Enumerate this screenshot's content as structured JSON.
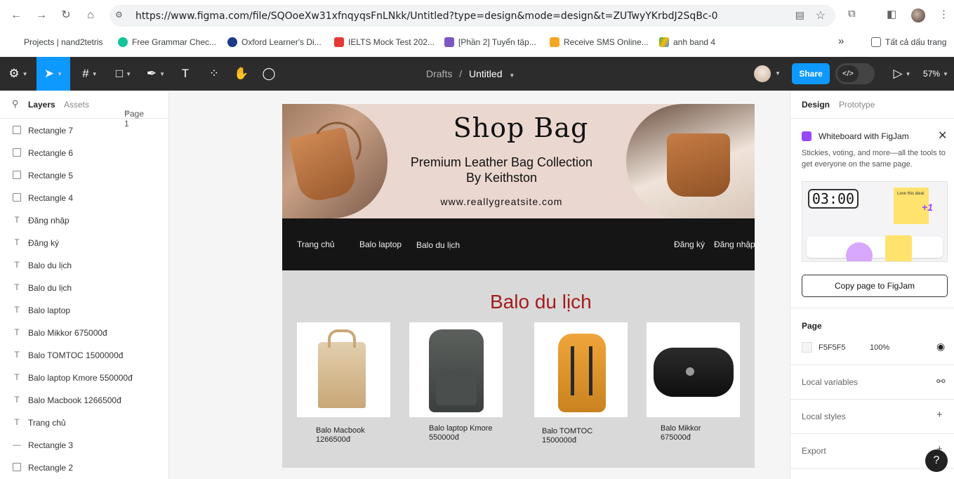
{
  "browser": {
    "url": "https://www.figma.com/file/SQOoeXw31xfnqyqsFnLNkk/Untitled?type=design&mode=design&t=ZUTwyYKrbdJ2SqBc-0",
    "bookmarks": [
      {
        "label": "Projects | nand2tetris",
        "color": "#ffffff"
      },
      {
        "label": "Free Grammar Chec...",
        "color": "#15c39a"
      },
      {
        "label": "Oxford Learner's Di...",
        "color": "#1d3a8a"
      },
      {
        "label": "IELTS Mock Test 202...",
        "color": "#e53935"
      },
      {
        "label": "[Phần 2] Tuyển tập...",
        "color": "#7e57c2"
      },
      {
        "label": "Receive SMS Online...",
        "color": "#f5a623"
      },
      {
        "label": "anh band 4",
        "color": "#34a853"
      }
    ],
    "bookmarks_more": "»",
    "all_bookmarks": "Tất cả dấu trang"
  },
  "toolbar": {
    "breadcrumb_parent": "Drafts",
    "breadcrumb_sep": "/",
    "file_name": "Untitled",
    "share_label": "Share",
    "zoom": "57%",
    "accent": "#0d99ff"
  },
  "left_panel": {
    "tab_layers": "Layers",
    "tab_assets": "Assets",
    "page_selector": "Page 1",
    "layers": [
      {
        "name": "Rectangle 7",
        "icon": "image"
      },
      {
        "name": "Rectangle 6",
        "icon": "image"
      },
      {
        "name": "Rectangle 5",
        "icon": "image"
      },
      {
        "name": "Rectangle 4",
        "icon": "image"
      },
      {
        "name": "Đăng nhập",
        "icon": "text"
      },
      {
        "name": "Đăng ký",
        "icon": "text"
      },
      {
        "name": "Balo du lịch",
        "icon": "text"
      },
      {
        "name": "Balo du lịch",
        "icon": "text"
      },
      {
        "name": "Balo laptop",
        "icon": "text"
      },
      {
        "name": "Balo Mikkor 675000đ",
        "icon": "text"
      },
      {
        "name": "Balo TOMTOC 1500000đ",
        "icon": "text"
      },
      {
        "name": "Balo laptop Kmore 550000đ",
        "icon": "text"
      },
      {
        "name": "Balo Macbook 1266500đ",
        "icon": "text"
      },
      {
        "name": "Trang chủ",
        "icon": "text"
      },
      {
        "name": "Rectangle 3",
        "icon": "line"
      },
      {
        "name": "Rectangle 2",
        "icon": "image"
      }
    ]
  },
  "design": {
    "hero_title": "Shop Bag",
    "hero_subtitle_1": "Premium Leather Bag Collection",
    "hero_subtitle_2": "By Keithston",
    "hero_url": "www.reallygreatsite.com",
    "nav": [
      "Trang chủ",
      "Balo laptop",
      "Balo du lịch",
      "Đăng ký",
      "Đăng nhập"
    ],
    "section_title": "Balo du lịch",
    "products": [
      {
        "name": "Balo Macbook",
        "price": "1266500đ"
      },
      {
        "name": "Balo laptop Kmore",
        "price": "550000đ"
      },
      {
        "name": "Balo TOMTOC",
        "price": "1500000đ"
      },
      {
        "name": "Balo Mikkor",
        "price": "675000đ"
      }
    ]
  },
  "right_panel": {
    "tab_design": "Design",
    "tab_prototype": "Prototype",
    "figjam_title": "Whiteboard with FigJam",
    "figjam_desc": "Stickies, voting, and more—all the tools to get everyone on the same page.",
    "figjam_timer": "03:00",
    "figjam_sticky": "Love this idea!",
    "figjam_plus": "+1",
    "figjam_button": "Copy page to FigJam",
    "page_label": "Page",
    "page_color": "F5F5F5",
    "page_opacity": "100%",
    "local_variables": "Local variables",
    "local_styles": "Local styles",
    "export": "Export",
    "help": "?"
  }
}
